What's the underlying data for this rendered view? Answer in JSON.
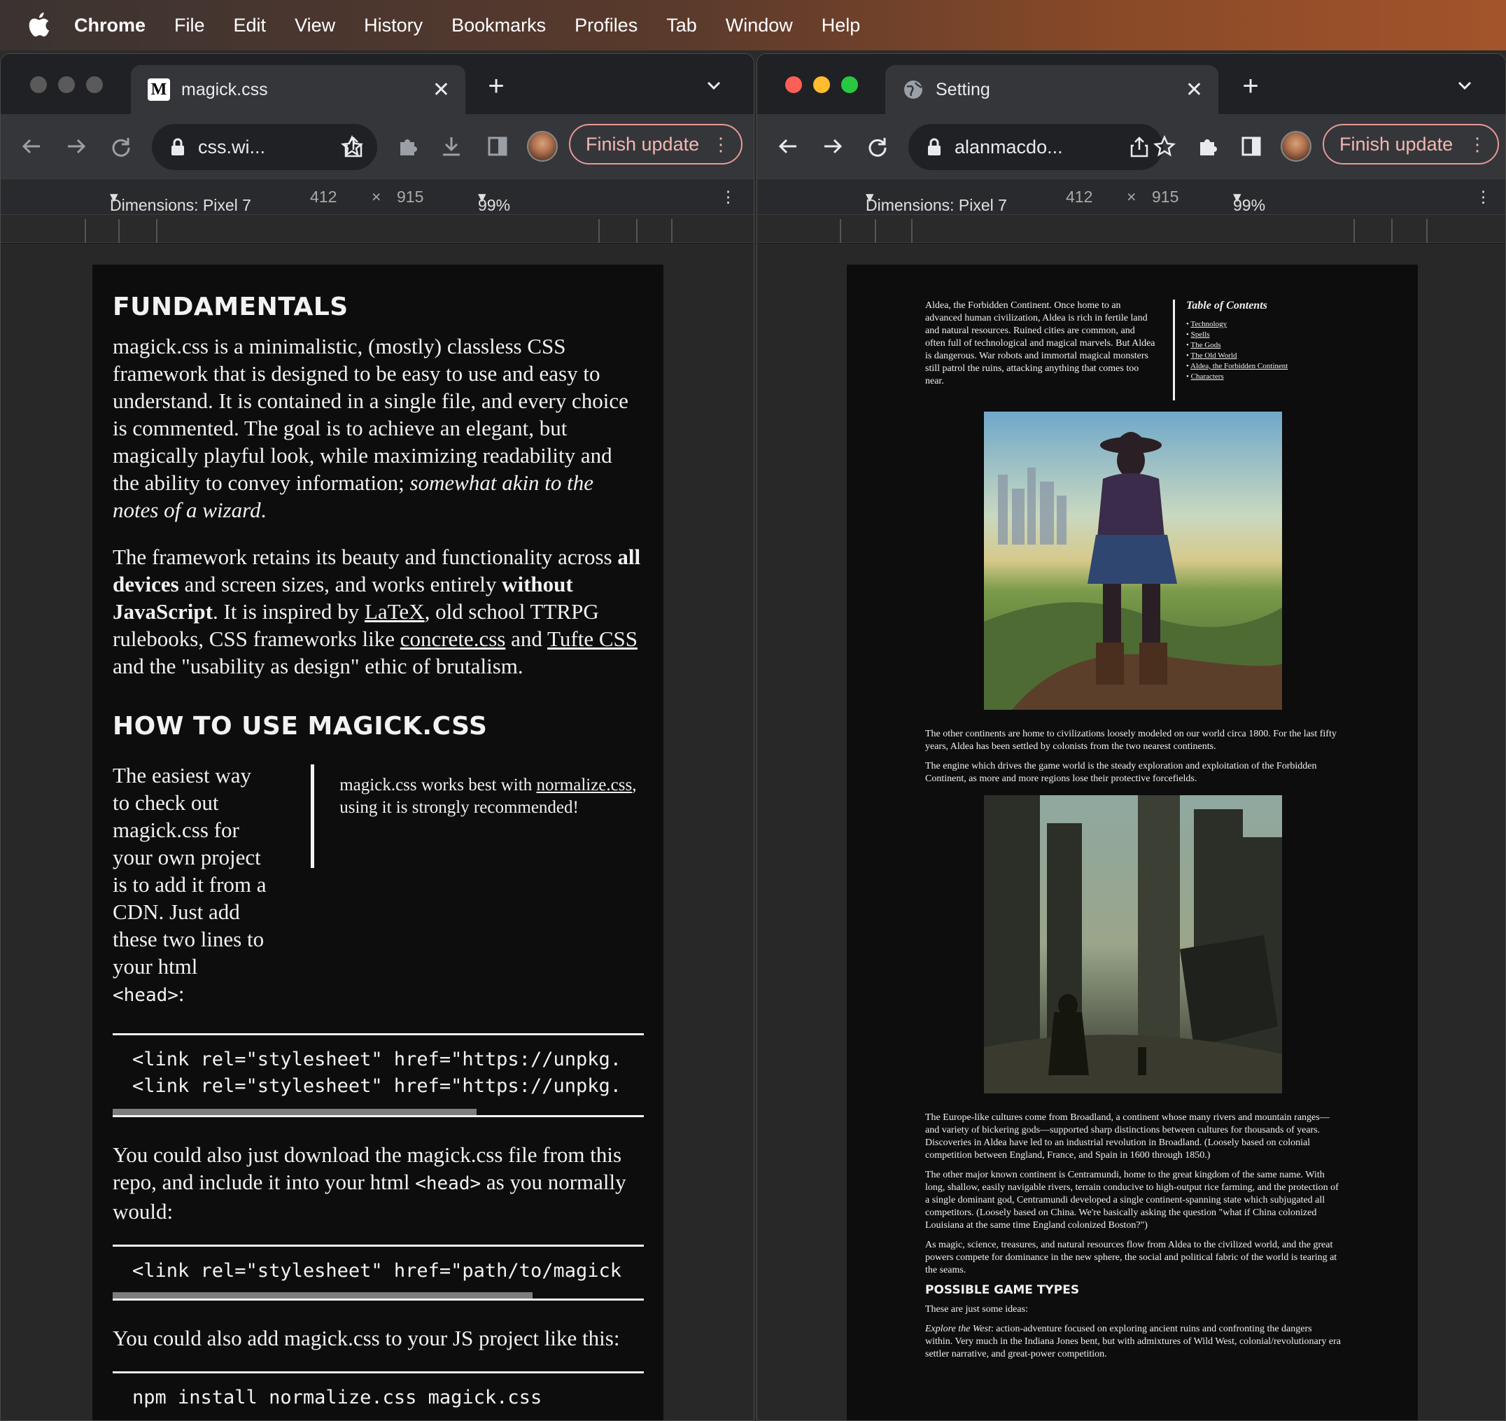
{
  "menubar": {
    "items": [
      "Chrome",
      "File",
      "Edit",
      "View",
      "History",
      "Bookmarks",
      "Profiles",
      "Tab",
      "Window",
      "Help"
    ]
  },
  "left_window": {
    "tab_favicon": "M",
    "tab_title": "magick.css",
    "url": "css.wi...",
    "finish_update": "Finish update",
    "device": "Dimensions: Pixel 7",
    "width": "412",
    "times": "×",
    "height": "915",
    "zoom": "99%",
    "page": {
      "h_fundamentals": "FUNDAMENTALS",
      "p1_a": "magick.css is a minimalistic, (mostly) classless CSS framework that is designed to be easy to use and easy to understand. It is contained in a single file, and every choice is commented. The goal is to achieve an elegant, but magically playful look, while maximizing readability and the ability to convey information; ",
      "p1_em": "somewhat akin to the notes of a wizard",
      "p1_end": ".",
      "p2_a": "The framework retains its beauty and functionality across ",
      "p2_b1": "all devices",
      "p2_c": " and screen sizes, and works entirely ",
      "p2_b2": "without JavaScript",
      "p2_d": ". It is inspired by ",
      "link_latex": "LaTeX",
      "p2_e": ", old school TTRPG rulebooks, CSS frameworks like ",
      "link_concrete": "concrete.css",
      "p2_f": " and ",
      "link_tufte": "Tufte CSS",
      "p2_g": " and the \"usability as design\" ethic of brutalism.",
      "h_howto": "HOW TO USE MAGICK.CSS",
      "p3": "The easiest way to check out magick.css for your own project is to add it from a CDN. Just add these two lines to your html ",
      "p3_code": "<head>",
      "p3_end": ":",
      "aside_a": "magick.css works best with ",
      "aside_link": "normalize.css",
      "aside_b": ", using it is strongly recommended!",
      "code1": "<link rel=\"stylesheet\" href=\"https://unpkg.\n<link rel=\"stylesheet\" href=\"https://unpkg.",
      "p4": "You could also just download the magick.css file from this repo, and include it into your html ",
      "p4_code": "<head>",
      "p4_end": " as you normally would:",
      "code2": "<link rel=\"stylesheet\" href=\"path/to/magick",
      "p5": "You could also add magick.css to your JS project like this:",
      "code3": "npm install normalize.css magick.css"
    }
  },
  "right_window": {
    "tab_title": "Setting",
    "url": "alanmacdo...",
    "finish_update": "Finish update",
    "device": "Dimensions: Pixel 7",
    "width": "412",
    "times": "×",
    "height": "915",
    "zoom": "99%",
    "page": {
      "intro": "Aldea, the Forbidden Continent. Once home to an advanced human civilization, Aldea is rich in fertile land and natural resources. Ruined cities are common, and often full of technological and magical marvels. But Aldea is dangerous. War robots and immortal magical monsters still patrol the ruins, attacking anything that comes too near.",
      "toc_title": "Table of Contents",
      "toc": [
        "Technology",
        "Spells",
        "The Gods",
        "The Old World",
        "Aldea, the Forbidden Continent",
        "Characters"
      ],
      "p1": "The other continents are home to civilizations loosely modeled on our world circa 1800. For the last fifty years, Aldea has been settled by colonists from the two nearest continents.",
      "p2": "The engine which drives the game world is the steady exploration and exploitation of the Forbidden Continent, as more and more regions lose their protective forcefields.",
      "p3": "The Europe-like cultures come from Broadland, a continent whose many rivers and mountain ranges—and variety of bickering gods—supported sharp distinctions between cultures for thousands of years. Discoveries in Aldea have led to an industrial revolution in Broadland. (Loosely based on colonial competition between England, France, and Spain in 1600 through 1850.)",
      "p4": "The other major known continent is Centramundi, home to the great kingdom of the same name. With long, shallow, easily navigable rivers, terrain conducive to high-output rice farming, and the protection of a single dominant god, Centramundi developed a single continent-spanning state which subjugated all competitors. (Loosely based on China. We're basically asking the question \"what if China colonized Louisiana at the same time England colonized Boston?\")",
      "p5": "As magic, science, treasures, and natural resources flow from Aldea to the civilized world, and the great powers compete for dominance in the new sphere, the social and political fabric of the world is tearing at the seams.",
      "h_types": "POSSIBLE GAME TYPES",
      "p6": "These are just some ideas:",
      "p7_em": "Explore the West",
      "p7": ": action-adventure focused on exploring ancient ruins and confronting the dangers within. Very much in the Indiana Jones bent, but with admixtures of Wild West, colonial/revolutionary era settler narrative, and great-power competition."
    }
  },
  "colors": {
    "finish_update_border": "#e59b94",
    "traffic_red": "#ff5f57",
    "traffic_yellow": "#febc2e",
    "traffic_green": "#28c840"
  }
}
